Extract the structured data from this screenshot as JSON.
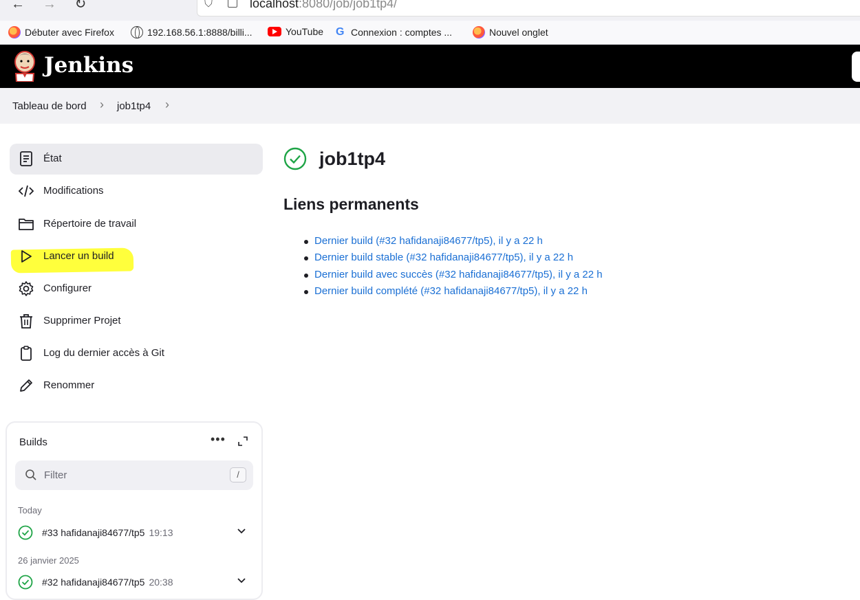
{
  "browser": {
    "url_host": "localhost",
    "url_rest": ":8080/job/job1tp4/",
    "bookmarks": [
      {
        "label": "Débuter avec Firefox",
        "icon": "firefox-icon"
      },
      {
        "label": "192.168.56.1:8888/billi...",
        "icon": "globe-icon"
      },
      {
        "label": "YouTube",
        "icon": "youtube-icon"
      },
      {
        "label": "Connexion : comptes ...",
        "icon": "google-icon"
      },
      {
        "label": "Nouvel onglet",
        "icon": "firefox-icon"
      }
    ]
  },
  "header": {
    "title": "Jenkins"
  },
  "breadcrumb": {
    "items": [
      "Tableau de bord",
      "job1tp4"
    ]
  },
  "sidebar": {
    "items": [
      {
        "label": "État",
        "icon": "document-icon"
      },
      {
        "label": "Modifications",
        "icon": "code-icon"
      },
      {
        "label": "Répertoire de travail",
        "icon": "folder-icon"
      },
      {
        "label": "Lancer un build",
        "icon": "play-icon"
      },
      {
        "label": "Configurer",
        "icon": "gear-icon"
      },
      {
        "label": "Supprimer Projet",
        "icon": "trash-icon"
      },
      {
        "label": "Log du dernier accès à Git",
        "icon": "clipboard-icon"
      },
      {
        "label": "Renommer",
        "icon": "pencil-icon"
      }
    ],
    "highlight_color": "#ffff3c"
  },
  "builds": {
    "title": "Builds",
    "filter_placeholder": "Filter",
    "filter_shortcut": "/",
    "groups": [
      {
        "label": "Today",
        "builds": [
          {
            "name": "#33 hafidanaji84677/tp5",
            "time": "19:13"
          }
        ]
      },
      {
        "label": "26 janvier 2025",
        "builds": [
          {
            "name": "#32 hafidanaji84677/tp5",
            "time": "20:38"
          }
        ]
      }
    ]
  },
  "main": {
    "job_name": "job1tp4",
    "section_title": "Liens permanents",
    "permalinks": [
      "Dernier build (#32 hafidanaji84677/tp5), il y a 22 h",
      "Dernier build stable (#32 hafidanaji84677/tp5), il y a 22 h",
      "Dernier build avec succès (#32 hafidanaji84677/tp5), il y a 22 h",
      "Dernier build complété (#32 hafidanaji84677/tp5), il y a 22 h"
    ]
  },
  "colors": {
    "success": "#1ea446",
    "link": "#1a6fd4",
    "header_bg": "#000000"
  }
}
